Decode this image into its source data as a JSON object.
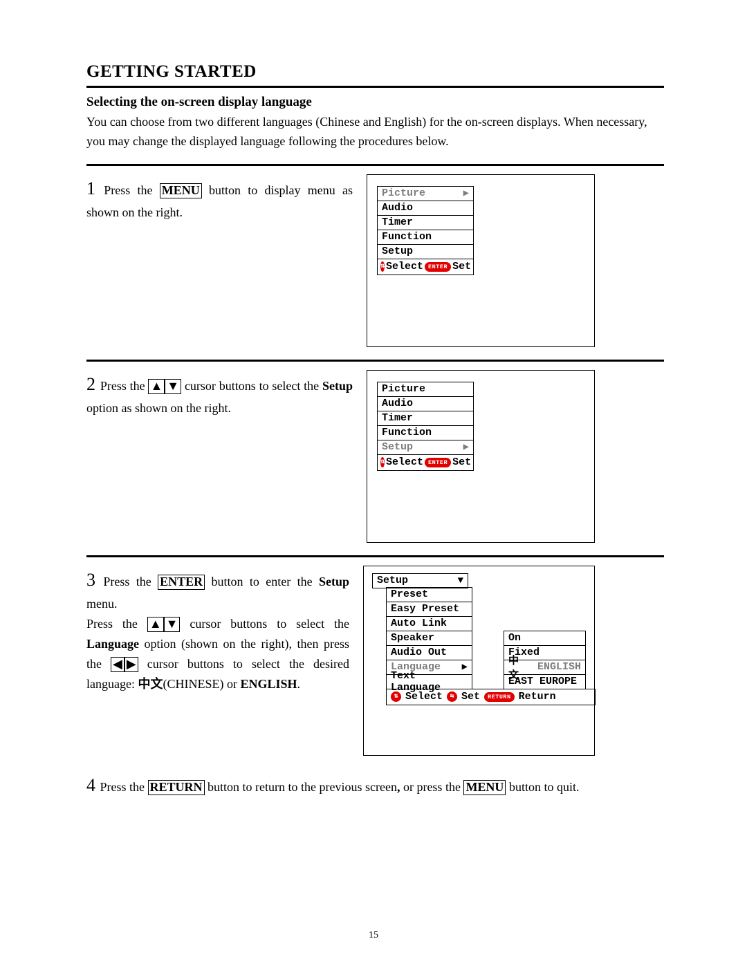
{
  "page_number": "15",
  "heading": "GETTING STARTED",
  "subheading": "Selecting the on-screen display language",
  "intro": "You can choose from two different languages (Chinese and English) for the on-screen displays. When necessary, you may change the displayed language following the procedures below.",
  "step1": {
    "num": "1",
    "pre": "Press the ",
    "btn": "MENU",
    "post": " button to display menu as shown on the right."
  },
  "menu_items": {
    "picture": "Picture",
    "audio": "Audio",
    "timer": "Timer",
    "function": "Function",
    "setup": "Setup"
  },
  "footer_simple": {
    "select": "Select",
    "enter_pill": "ENTER",
    "set": "Set"
  },
  "step2": {
    "num": "2",
    "pre": "Press the ",
    "mid": " cursor buttons to select the ",
    "bold": "Setup",
    "post": " option as shown on the right."
  },
  "step3": {
    "num": "3",
    "l1a": "Press the ",
    "l1btn": "ENTER",
    "l1b": " button to enter the ",
    "l1bold": "Setup",
    "l1c": " menu.",
    "l2a": "Press the ",
    "l2b": " cursor buttons to select the ",
    "l2bold": "Language",
    "l2c": " option (shown on the right), then press the ",
    "l2d": " cursor buttons to select the desired language:  ",
    "chinese_glyph": "中文",
    "chinese_paren": "(CHINESE)",
    "or": " or ",
    "english": "ENGLISH",
    "dot": "."
  },
  "setup_menu": {
    "head": "Setup",
    "rows": {
      "preset": "Preset",
      "easy_preset": "Easy Preset",
      "auto_link": "Auto Link",
      "speaker": "Speaker",
      "speaker_val": "On",
      "audio_out": "Audio Out",
      "audio_out_val": "Fixed",
      "language": "Language",
      "lang_cn": "中文",
      "lang_en": "ENGLISH",
      "text_lang": "Text Language",
      "text_lang_val": "EAST EUROPE"
    },
    "footer": {
      "select": "Select",
      "set": "Set",
      "return_pill": "RETURN",
      "return": "Return"
    }
  },
  "step4": {
    "num": "4",
    "a": "Press the ",
    "btn1": "RETURN",
    "b": " button to return to the previous screen",
    "comma": ",",
    "c": " or press the ",
    "btn2": "MENU",
    "d": " button to quit."
  },
  "glyphs": {
    "up": "▲",
    "down": "▼",
    "left": "◀",
    "right": "▶",
    "updown": "⇅",
    "leftright": "⇆"
  }
}
